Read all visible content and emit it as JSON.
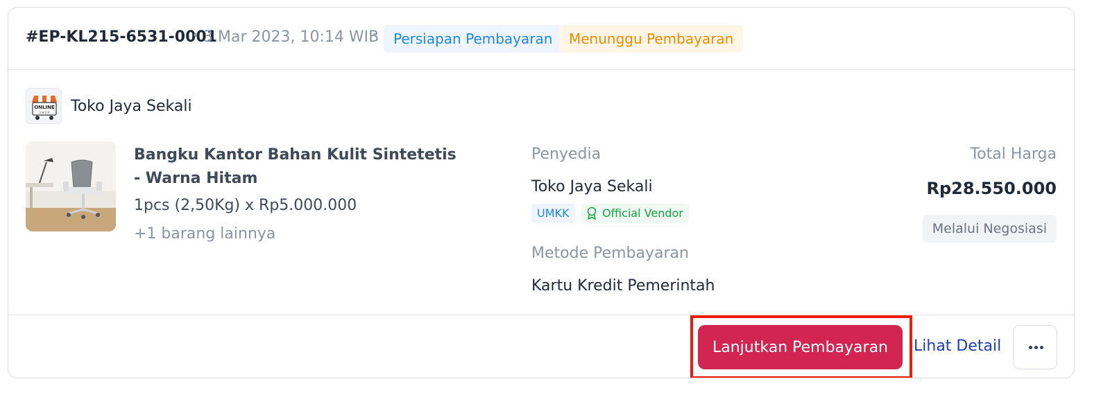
{
  "order": {
    "id": "#EP-KL215-6531-0001",
    "separator": "•",
    "date": "3 Mar 2023, 10:14 WIB",
    "status_primary": "Persiapan Pembayaran",
    "status_secondary": "Menunggu Pembayaran"
  },
  "store": {
    "name": "Toko Jaya Sekali",
    "logo_text": "ONLINE",
    "logo_subtext": "S H O P"
  },
  "product": {
    "title": "Bangku Kantor Bahan Kulit Sintetetis - Warna Hitam",
    "quantity_line": "1pcs (2,50Kg) x Rp5.000.000",
    "more_items": "+1 barang lainnya"
  },
  "vendor": {
    "label": "Penyedia",
    "name": "Toko Jaya Sekali",
    "tags": [
      "UMKK",
      "Official Vendor"
    ],
    "payment_label": "Metode Pembayaran",
    "payment_method": "Kartu Kredit Pemerintah"
  },
  "price": {
    "label": "Total Harga",
    "total": "Rp28.550.000",
    "note": "Melalui Negosiasi"
  },
  "actions": {
    "pay_label": "Lanjutkan Pembayaran",
    "detail_label": "Lihat Detail",
    "more_icon": "more-horizontal-icon"
  },
  "colors": {
    "primary_button": "#d22552",
    "highlight": "#ef1c0d",
    "link": "#1e40af",
    "badge_blue": "#1e88e5",
    "badge_orange": "#f08c00",
    "official_green": "#16a34a"
  }
}
